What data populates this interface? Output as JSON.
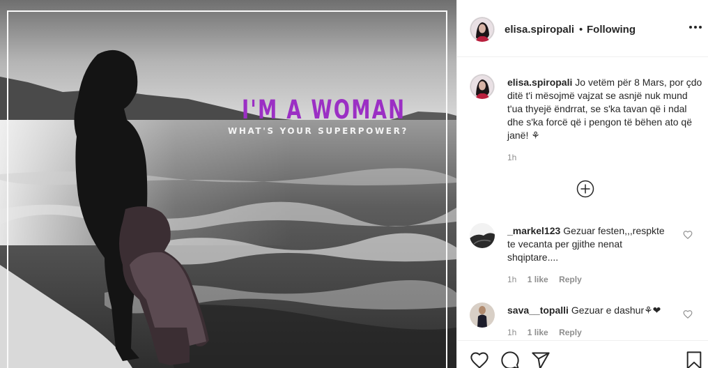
{
  "post": {
    "image": {
      "headline": "I'M A WOMAN",
      "subline": "WHAT'S YOUR SUPERPOWER?",
      "headline_color": "#9b2fc4"
    }
  },
  "header": {
    "username": "elisa.spiropali",
    "separator": "•",
    "follow_status": "Following",
    "more_icon": "more-horizontal-icon"
  },
  "caption": {
    "username": "elisa.spiropali",
    "text": "Jo vetëm për 8 Mars, por çdo ditë t'i mësojmë vajzat se asnjë nuk mund t'ua thyejë ëndrrat, se s'ka tavan që i ndal dhe s'ka forcë që i pengon të bëhen ato që janë! ⚘",
    "time": "1h"
  },
  "load_more_icon": "plus-circle-icon",
  "comments": [
    {
      "username": "_markel123",
      "text": "Gezuar festen,,,respkte te vecanta per gjithe nenat shqiptare....",
      "time": "1h",
      "likes": "1 like",
      "reply": "Reply"
    },
    {
      "username": "sava__topalli",
      "text": "Gezuar e dashur⚘❤",
      "time": "1h",
      "likes": "1 like",
      "reply": "Reply"
    }
  ],
  "actions": {
    "like_icon": "heart-icon",
    "comment_icon": "comment-icon",
    "share_icon": "share-icon",
    "save_icon": "bookmark-icon"
  },
  "colors": {
    "text": "#262626",
    "muted": "#8e8e8e",
    "divider": "#efefef"
  }
}
